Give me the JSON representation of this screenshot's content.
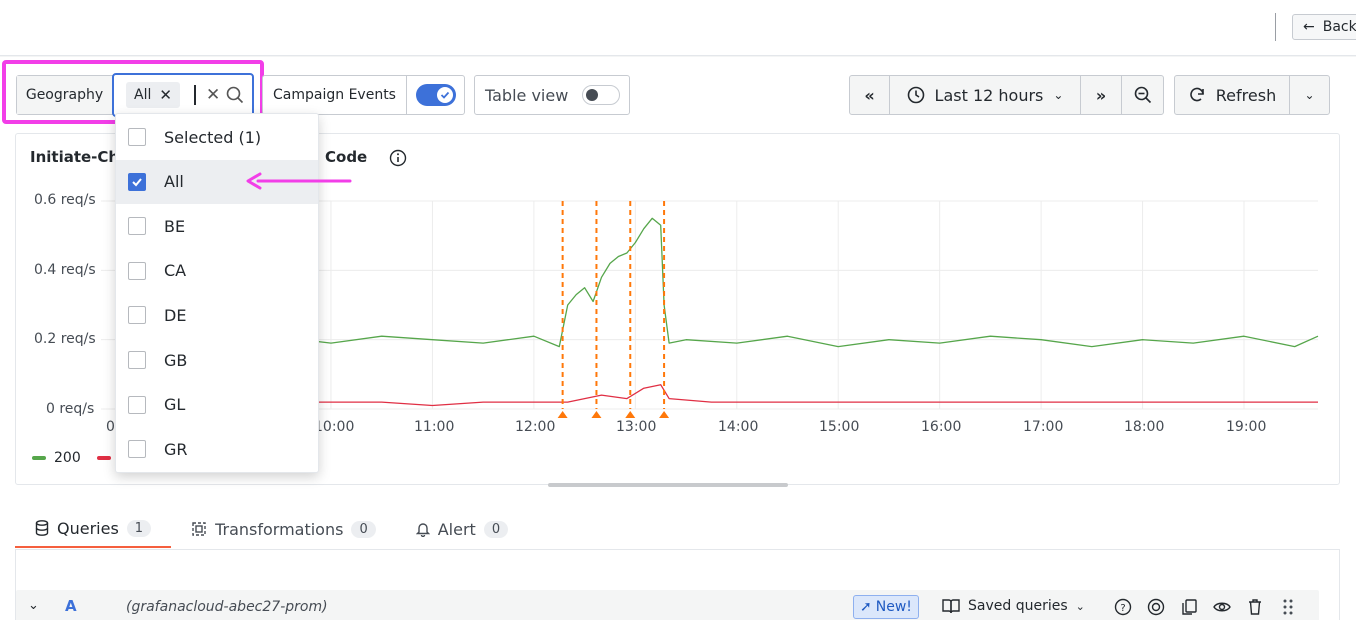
{
  "header": {
    "back_label": "Back"
  },
  "toolbar": {
    "geography_label": "Geography",
    "geography_chip": "All",
    "campaign_label": "Campaign Events",
    "campaign_enabled": true,
    "table_view_label": "Table view",
    "table_view_enabled": false,
    "time_range": "Last 12 hours",
    "refresh_label": "Refresh"
  },
  "dropdown": {
    "options": [
      {
        "label": "Selected (1)",
        "checked": false
      },
      {
        "label": "All",
        "checked": true
      },
      {
        "label": "BE",
        "checked": false
      },
      {
        "label": "CA",
        "checked": false
      },
      {
        "label": "DE",
        "checked": false
      },
      {
        "label": "GB",
        "checked": false
      },
      {
        "label": "GL",
        "checked": false
      },
      {
        "label": "GR",
        "checked": false
      }
    ]
  },
  "panel": {
    "title_left": "Initiate-Ch",
    "title_right": "Code"
  },
  "chart_data": {
    "type": "line",
    "x_tick_labels": [
      "0",
      "10:00",
      "11:00",
      "12:00",
      "13:00",
      "14:00",
      "15:00",
      "16:00",
      "17:00",
      "18:00",
      "19:00"
    ],
    "y_tick_labels": [
      "0.6 req/s",
      "0.4 req/s",
      "0.2 req/s",
      "0 req/s"
    ],
    "ylim": [
      0,
      0.6
    ],
    "grid": true,
    "legend_position": "bottom-left",
    "series": [
      {
        "name": "200",
        "color": "#56a64b",
        "x": [
          "09:43",
          "10:00",
          "10:30",
          "11:00",
          "11:30",
          "12:00",
          "12:15",
          "12:20",
          "12:25",
          "12:30",
          "12:35",
          "12:40",
          "12:45",
          "12:50",
          "12:55",
          "13:00",
          "13:05",
          "13:10",
          "13:15",
          "13:17",
          "13:20",
          "13:30",
          "14:00",
          "14:30",
          "15:00",
          "15:30",
          "16:00",
          "16:30",
          "17:00",
          "17:30",
          "18:00",
          "18:30",
          "19:00",
          "19:30",
          "19:45"
        ],
        "values": [
          0.2,
          0.19,
          0.21,
          0.2,
          0.19,
          0.21,
          0.18,
          0.3,
          0.33,
          0.35,
          0.31,
          0.38,
          0.42,
          0.44,
          0.45,
          0.48,
          0.52,
          0.55,
          0.53,
          0.3,
          0.19,
          0.2,
          0.19,
          0.21,
          0.18,
          0.2,
          0.19,
          0.21,
          0.2,
          0.18,
          0.2,
          0.19,
          0.21,
          0.18,
          0.21
        ]
      },
      {
        "name": "",
        "color": "#e02f44",
        "x": [
          "09:43",
          "10:30",
          "11:00",
          "11:30",
          "12:00",
          "12:20",
          "12:40",
          "12:55",
          "13:05",
          "13:15",
          "13:20",
          "13:45",
          "14:30",
          "15:30",
          "16:30",
          "17:30",
          "18:30",
          "19:45"
        ],
        "values": [
          0.02,
          0.02,
          0.01,
          0.02,
          0.02,
          0.02,
          0.04,
          0.03,
          0.06,
          0.07,
          0.03,
          0.02,
          0.02,
          0.02,
          0.02,
          0.02,
          0.02,
          0.02
        ]
      }
    ],
    "annotations": [
      "12:17",
      "12:37",
      "12:57",
      "13:17"
    ]
  },
  "tabs": [
    {
      "label": "Queries",
      "count": "1"
    },
    {
      "label": "Transformations",
      "count": "0"
    },
    {
      "label": "Alert",
      "count": "0"
    }
  ],
  "query": {
    "ref": "A",
    "source": "(grafanacloud-abec27-prom)",
    "new_label": "New!",
    "saved_label": "Saved queries"
  }
}
